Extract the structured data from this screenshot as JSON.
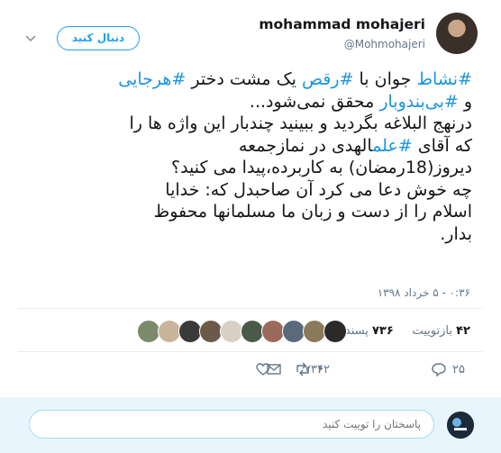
{
  "tweet": {
    "author_name": "mohammad mohajeri",
    "author_handle": "@Mohmohajeri",
    "follow_label": "دنبال کنید",
    "body_segments": [
      {
        "text": "#نشاط",
        "type": "hashtag"
      },
      {
        "text": " جوان با ",
        "type": "text"
      },
      {
        "text": "#رقص",
        "type": "hashtag"
      },
      {
        "text": " یک مشت دختر ",
        "type": "text"
      },
      {
        "text": "#هرجایی",
        "type": "hashtag"
      },
      {
        "text": "\nو ",
        "type": "text"
      },
      {
        "text": "#بی‌بندوبار",
        "type": "hashtag"
      },
      {
        "text": " محقق نمی‌شود...\nدرنهج البلاغه بگردید و ببینید چندبار این واژه ها را\nکه آقای ",
        "type": "text"
      },
      {
        "text": "#علم",
        "type": "hashtag"
      },
      {
        "text": "الهدی در نمازجمعه\nدیروز(18رمضان) به کاربرده،پیدا می کنید؟\nچه خوش دعا می کرد آن صاحبدل که: خدایا\nاسلام را از دست و زبان ما مسلمانها محفوظ\nبدار.",
        "type": "text"
      }
    ],
    "timestamp": "۰:۳۶ - ۵ خرداد ۱۳۹۸",
    "retweets_count": "۴۲",
    "retweets_label": "بازتوییت",
    "likes_count": "۷۳۶",
    "likes_label": "پسند",
    "reply_count": "۲۵",
    "retweet_count_action": "۴۲",
    "like_count_action": "۷۳۶"
  },
  "likers": [
    {
      "color": "#7a8a6a"
    },
    {
      "color": "#c9b59a"
    },
    {
      "color": "#3a3a3a"
    },
    {
      "color": "#6b5a4a"
    },
    {
      "color": "#d8d0c4"
    },
    {
      "color": "#4a5a4a"
    },
    {
      "color": "#9a6a5a"
    },
    {
      "color": "#5a6a7a"
    },
    {
      "color": "#8a7a5a"
    },
    {
      "color": "#2a2a2a"
    }
  ],
  "reply": {
    "placeholder": "پاسختان را توییت کنید"
  },
  "colors": {
    "accent": "#1da1f2",
    "hashtag": "#1b95e0",
    "muted": "#657786",
    "reply_bg": "#e8f5fd"
  },
  "icons": {
    "reply": "reply-icon",
    "retweet": "retweet-icon",
    "like": "heart-icon",
    "message": "envelope-icon",
    "more": "chevron-down-icon"
  }
}
